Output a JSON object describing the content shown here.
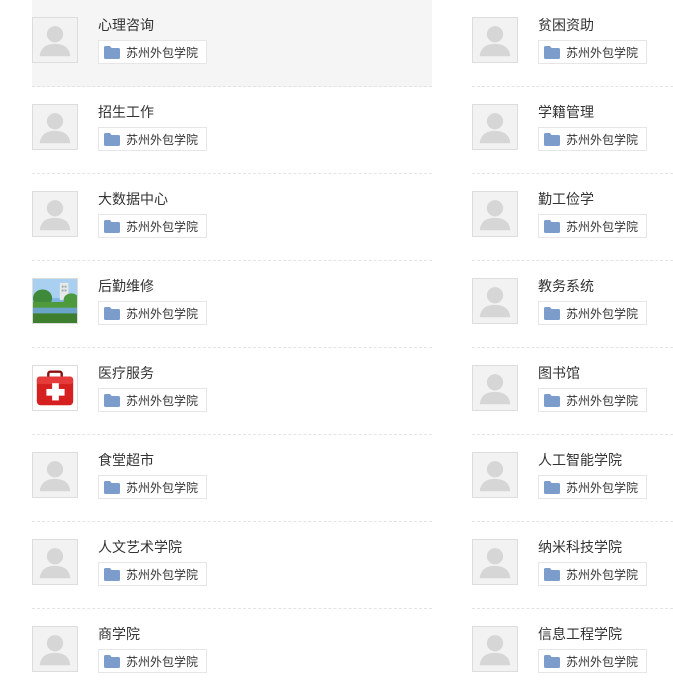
{
  "colors": {
    "folder": "#7c9ccc",
    "placeholder_bg": "#f2f2f2",
    "placeholder_fg": "#d6d6d6",
    "hover_bg": "#f5f5f5"
  },
  "left_items": [
    {
      "title": "心理咨询",
      "tag": "苏州外包学院",
      "thumb": "placeholder-avatar-icon",
      "active": true
    },
    {
      "title": "招生工作",
      "tag": "苏州外包学院",
      "thumb": "placeholder-avatar-icon"
    },
    {
      "title": "大数据中心",
      "tag": "苏州外包学院",
      "thumb": "placeholder-avatar-icon"
    },
    {
      "title": "后勤维修",
      "tag": "苏州外包学院",
      "thumb": "campus-photo-icon"
    },
    {
      "title": "医疗服务",
      "tag": "苏州外包学院",
      "thumb": "first-aid-kit-icon"
    },
    {
      "title": "食堂超市",
      "tag": "苏州外包学院",
      "thumb": "placeholder-avatar-icon"
    },
    {
      "title": "人文艺术学院",
      "tag": "苏州外包学院",
      "thumb": "placeholder-avatar-icon"
    },
    {
      "title": "商学院",
      "tag": "苏州外包学院",
      "thumb": "placeholder-avatar-icon"
    }
  ],
  "right_items": [
    {
      "title": "贫困资助",
      "tag": "苏州外包学院",
      "thumb": "placeholder-avatar-icon"
    },
    {
      "title": "学籍管理",
      "tag": "苏州外包学院",
      "thumb": "placeholder-avatar-icon"
    },
    {
      "title": "勤工俭学",
      "tag": "苏州外包学院",
      "thumb": "placeholder-avatar-icon"
    },
    {
      "title": "教务系统",
      "tag": "苏州外包学院",
      "thumb": "placeholder-avatar-icon"
    },
    {
      "title": "图书馆",
      "tag": "苏州外包学院",
      "thumb": "placeholder-avatar-icon"
    },
    {
      "title": "人工智能学院",
      "tag": "苏州外包学院",
      "thumb": "placeholder-avatar-icon"
    },
    {
      "title": "纳米科技学院",
      "tag": "苏州外包学院",
      "thumb": "placeholder-avatar-icon"
    },
    {
      "title": "信息工程学院",
      "tag": "苏州外包学院",
      "thumb": "placeholder-avatar-icon"
    }
  ]
}
